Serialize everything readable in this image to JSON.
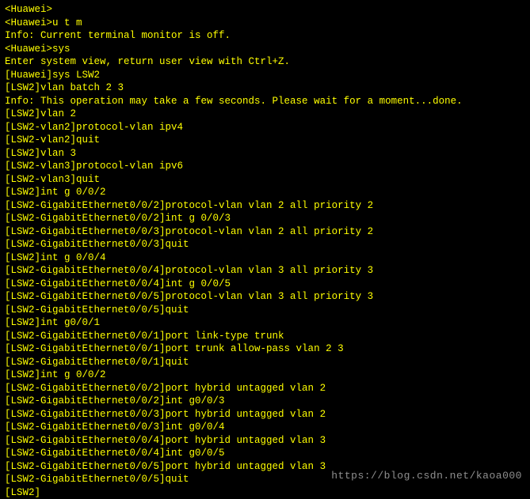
{
  "terminal": {
    "lines": [
      "<Huawei>",
      "<Huawei>u t m",
      "Info: Current terminal monitor is off.",
      "<Huawei>sys",
      "Enter system view, return user view with Ctrl+Z.",
      "[Huawei]sys LSW2",
      "[LSW2]vlan batch 2 3",
      "Info: This operation may take a few seconds. Please wait for a moment...done.",
      "[LSW2]vlan 2",
      "[LSW2-vlan2]protocol-vlan ipv4",
      "[LSW2-vlan2]quit",
      "[LSW2]vlan 3",
      "[LSW2-vlan3]protocol-vlan ipv6",
      "[LSW2-vlan3]quit",
      "[LSW2]int g 0/0/2",
      "[LSW2-GigabitEthernet0/0/2]protocol-vlan vlan 2 all priority 2",
      "[LSW2-GigabitEthernet0/0/2]int g 0/0/3",
      "[LSW2-GigabitEthernet0/0/3]protocol-vlan vlan 2 all priority 2",
      "[LSW2-GigabitEthernet0/0/3]quit",
      "[LSW2]int g 0/0/4",
      "[LSW2-GigabitEthernet0/0/4]protocol-vlan vlan 3 all priority 3",
      "[LSW2-GigabitEthernet0/0/4]int g 0/0/5",
      "[LSW2-GigabitEthernet0/0/5]protocol-vlan vlan 3 all priority 3",
      "[LSW2-GigabitEthernet0/0/5]quit",
      "[LSW2]int g0/0/1",
      "[LSW2-GigabitEthernet0/0/1]port link-type trunk",
      "[LSW2-GigabitEthernet0/0/1]port trunk allow-pass vlan 2 3",
      "[LSW2-GigabitEthernet0/0/1]quit",
      "[LSW2]int g 0/0/2",
      "[LSW2-GigabitEthernet0/0/2]port hybrid untagged vlan 2",
      "[LSW2-GigabitEthernet0/0/2]int g0/0/3",
      "[LSW2-GigabitEthernet0/0/3]port hybrid untagged vlan 2",
      "[LSW2-GigabitEthernet0/0/3]int g0/0/4",
      "[LSW2-GigabitEthernet0/0/4]port hybrid untagged vlan 3",
      "[LSW2-GigabitEthernet0/0/4]int g0/0/5",
      "[LSW2-GigabitEthernet0/0/5]port hybrid untagged vlan 3",
      "[LSW2-GigabitEthernet0/0/5]quit",
      "[LSW2]"
    ]
  },
  "watermark": "https://blog.csdn.net/kaoa000"
}
